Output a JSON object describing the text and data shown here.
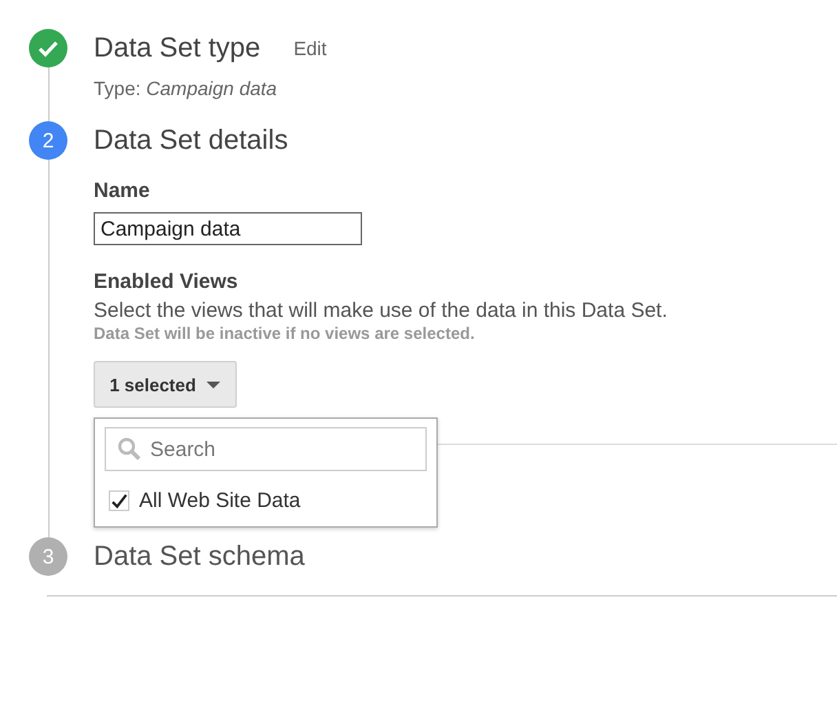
{
  "steps": [
    {
      "done": true,
      "active": false,
      "title": "Data Set type",
      "edit_link": "Edit",
      "summary": "Type: *Campaign data*"
    },
    {
      "done": false,
      "active": true,
      "number": "2",
      "title": "Data Set details",
      "name_label": "Name",
      "name_value": "Campaign data",
      "views_label": "Enabled Views",
      "views_description": "Select the views that will make use of the data in this Data Set.",
      "views_warning": "Data Set will be inactive if no views are selected.",
      "views_button": "1 selected",
      "dropdown": {
        "expanded": true,
        "search_placeholder": "Search",
        "options": [
          {
            "label": "All Web Site Data",
            "checked": true
          }
        ]
      }
    },
    {
      "done": false,
      "active": false,
      "number": "3",
      "title": "Data Set schema"
    }
  ]
}
